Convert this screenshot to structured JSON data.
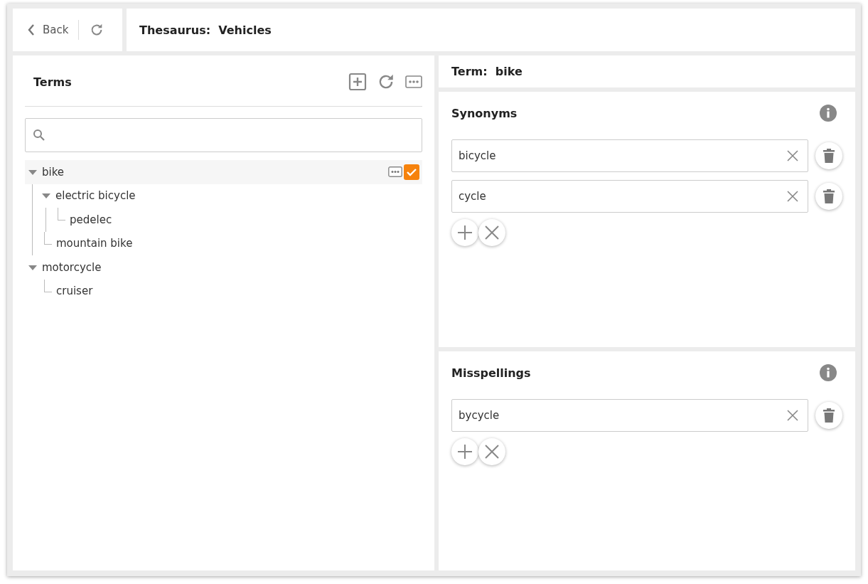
{
  "toolbar": {
    "back_label": "Back",
    "title": "Thesaurus:  Vehicles"
  },
  "terms": {
    "title": "Terms",
    "tree": [
      {
        "label": "bike",
        "selected": true,
        "checked": true,
        "expanded": true,
        "children": [
          {
            "label": "electric bicycle",
            "selected": false,
            "checked": false,
            "expanded": true,
            "children": [
              {
                "label": "pedelec",
                "selected": false,
                "checked": false
              }
            ]
          },
          {
            "label": "mountain bike",
            "selected": false,
            "checked": false
          }
        ]
      },
      {
        "label": "motorcycle",
        "selected": false,
        "checked": false,
        "expanded": true,
        "children": [
          {
            "label": "cruiser",
            "selected": false,
            "checked": false
          }
        ]
      }
    ]
  },
  "term_header": "Term:  bike",
  "sections": [
    {
      "title": "Synonyms",
      "values": [
        "bicycle",
        "cycle"
      ]
    },
    {
      "title": "Misspellings",
      "values": [
        "bycycle"
      ]
    }
  ]
}
